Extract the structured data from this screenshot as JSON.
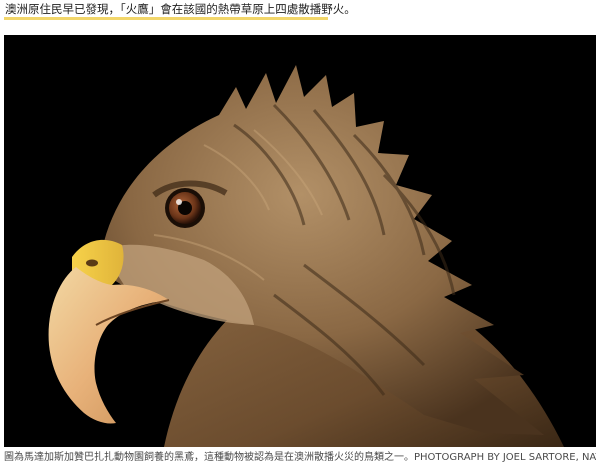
{
  "headline": {
    "text": "澳洲原住民早已發現，「火鷹」會在該國的熱帶草原上四處散播野火。"
  },
  "photo": {
    "subject": "black-kite-head-profile",
    "background_color": "#000000"
  },
  "caption": {
    "text": "圖為馬達加斯加贊巴扎扎動物園飼養的黑鳶，這種動物被認為是在澳洲散播火災的鳥類之一。PHOTOGRAPH BY JOEL SARTORE, NATIONAL GEOGRAPHIC PHOTO ARK"
  },
  "colors": {
    "highlight": "#f2d66a",
    "beak": "#e8b86a",
    "feather": "#7a5b3a"
  }
}
